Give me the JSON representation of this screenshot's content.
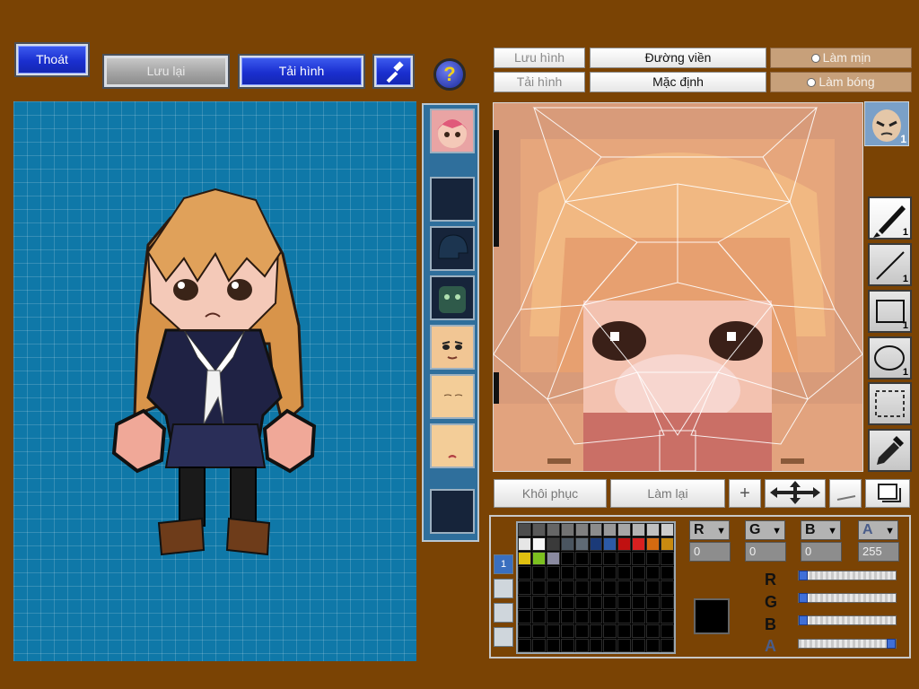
{
  "top_left": {
    "exit_label": "Thoát",
    "save_label": "Lưu lại",
    "load_label": "Tải hình",
    "tool_icon": "hammer-icon",
    "help_label": "?"
  },
  "editor_header": {
    "save_image_label": "Lưu hình",
    "load_image_label": "Tải hình",
    "outline_label": "Đường viền",
    "default_label": "Mặc định",
    "smooth_label": "Làm mịn",
    "shine_label": "Làm bóng"
  },
  "face_preview": {
    "count": "1"
  },
  "tools": [
    {
      "name": "brush-icon",
      "count": "1"
    },
    {
      "name": "line-icon",
      "count": "1"
    },
    {
      "name": "rectangle-icon",
      "count": "1"
    },
    {
      "name": "ellipse-icon",
      "count": "1"
    },
    {
      "name": "selection-icon",
      "count": ""
    },
    {
      "name": "eyedropper-icon",
      "count": ""
    }
  ],
  "action_bar": {
    "restore_label": "Khôi phục",
    "redo_label": "Làm lại",
    "add_symbol": "+",
    "move_icon": "move-icon",
    "line_icon": "thin-line-icon",
    "layer_icon": "layer-icon"
  },
  "palette": {
    "page_tab": "1",
    "swatches": [
      "#4d4d4d",
      "#595959",
      "#666666",
      "#737373",
      "#808080",
      "#8c8c8c",
      "#999999",
      "#a6a6a6",
      "#b3b3b3",
      "#c0c0c0",
      "#cccccc",
      "#e6e6e6",
      "#f5f5f5",
      "#3a3a3a",
      "#4a5560",
      "#5f6a75",
      "#1b3a78",
      "#2c5aa6",
      "#c01010",
      "#d82020",
      "#d46a10",
      "#c88a10",
      "#e0c010",
      "#7cc020",
      "#8a8aa0"
    ],
    "channels": {
      "r_label": "R",
      "g_label": "G",
      "b_label": "B",
      "a_label": "A",
      "r": "0",
      "g": "0",
      "b": "0",
      "a": "255"
    },
    "current_color": "#000000",
    "sliders": {
      "r": 0,
      "g": 0,
      "b": 0,
      "a": 255
    }
  }
}
